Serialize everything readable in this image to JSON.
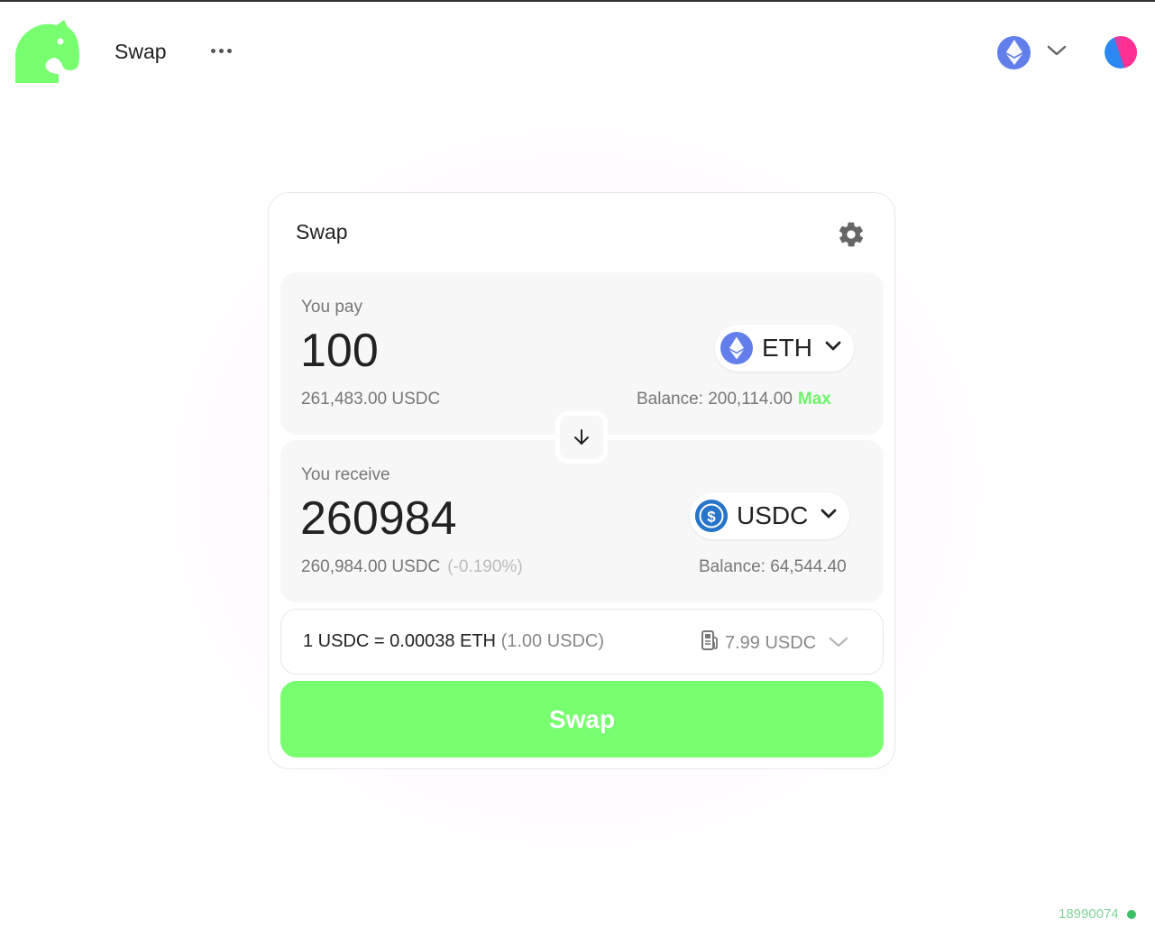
{
  "nav": {
    "swap_label": "Swap",
    "chain_icon": "ethereum-icon"
  },
  "card": {
    "title": "Swap",
    "pay": {
      "label": "You pay",
      "amount": "100",
      "fiat": "261,483.00 USDC",
      "token": "ETH",
      "balance": "Balance: 200,114.00",
      "max_label": "Max"
    },
    "receive": {
      "label": "You receive",
      "amount": "260984",
      "fiat": "260,984.00 USDC",
      "diff": "(-0.190%)",
      "token": "USDC",
      "balance": "Balance: 64,544.40"
    },
    "rate": {
      "main": "1 USDC = 0.00038 ETH",
      "fiat": "(1.00 USDC)",
      "gas": "7.99 USDC"
    },
    "swap_button": "Swap"
  },
  "footer": {
    "block_number": "18990074"
  },
  "colors": {
    "accent": "#77ff70",
    "max": "#6cf46c",
    "eth": "#627EEA",
    "usdc": "#2775CA",
    "block_dot": "#3cbf68"
  }
}
